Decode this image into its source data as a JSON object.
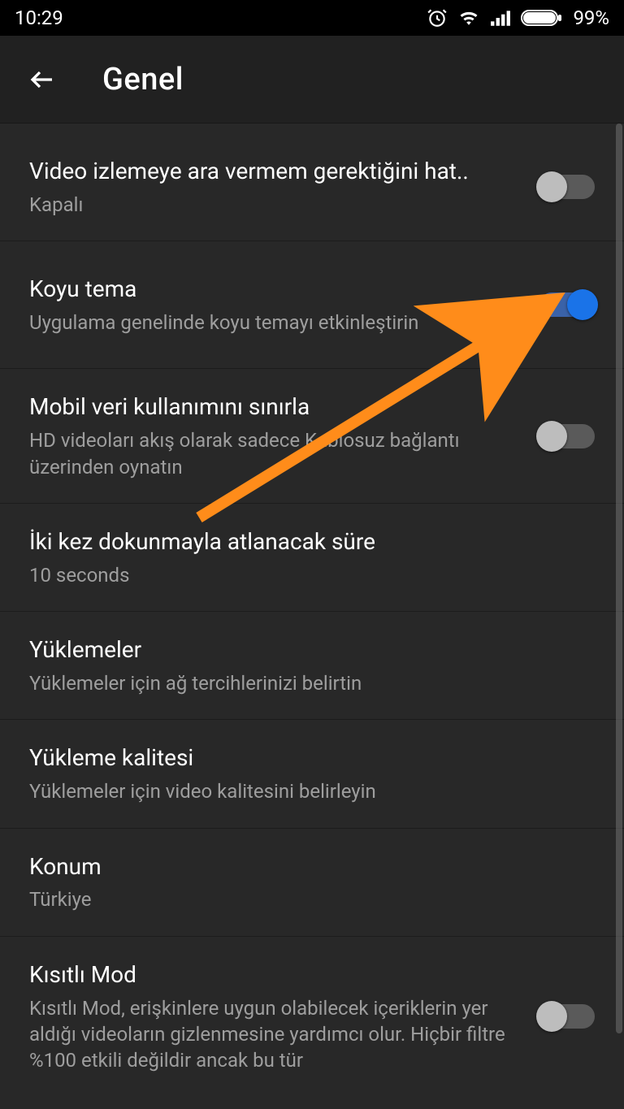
{
  "status": {
    "time": "10:29",
    "battery_pct": "99%"
  },
  "header": {
    "title": "Genel"
  },
  "rows": {
    "remind": {
      "title": "Video izlemeye ara vermem gerektiğini hat..",
      "sub": "Kapalı",
      "on": false
    },
    "dark": {
      "title": "Koyu tema",
      "sub": "Uygulama genelinde koyu temayı etkinleştirin",
      "on": true
    },
    "mobile": {
      "title": "Mobil veri kullanımını sınırla",
      "sub": "HD videoları akış olarak sadece Kablosuz bağlantı üzerinden oynatın",
      "on": false
    },
    "doubletap": {
      "title": "İki kez dokunmayla atlanacak süre",
      "sub": "10 seconds"
    },
    "uploads": {
      "title": "Yüklemeler",
      "sub": "Yüklemeler için ağ tercihlerinizi belirtin"
    },
    "uploadq": {
      "title": "Yükleme kalitesi",
      "sub": "Yüklemeler için video kalitesini belirleyin"
    },
    "location": {
      "title": "Konum",
      "sub": "Türkiye"
    },
    "restricted": {
      "title": "Kısıtlı Mod",
      "sub": "Kısıtlı Mod, erişkinlere uygun olabilecek içeriklerin yer aldığı videoların gizlenmesine yardımcı olur. Hiçbir filtre %100 etkili değildir ancak bu tür",
      "on": false
    }
  },
  "colors": {
    "accent": "#1a73e8",
    "arrow": "#ff8c1a"
  }
}
